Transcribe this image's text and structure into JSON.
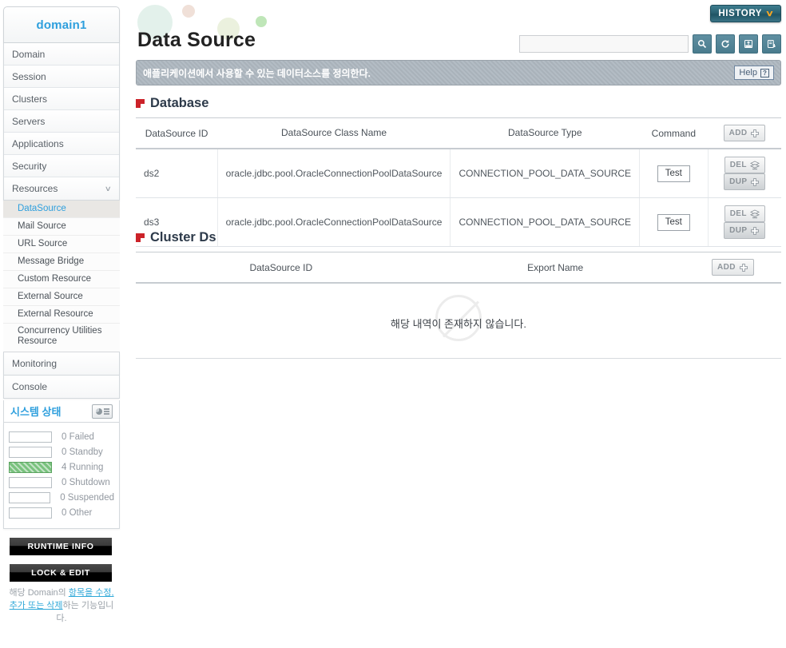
{
  "sidebar": {
    "domain_name": "domain1",
    "nav_items": [
      {
        "label": "Domain",
        "expandable": false
      },
      {
        "label": "Session",
        "expandable": false
      },
      {
        "label": "Clusters",
        "expandable": false
      },
      {
        "label": "Servers",
        "expandable": false
      },
      {
        "label": "Applications",
        "expandable": false
      },
      {
        "label": "Security",
        "expandable": false
      },
      {
        "label": "Resources",
        "expandable": true,
        "chevron": "∨"
      }
    ],
    "sub_items": [
      {
        "label": "DataSource",
        "active": true
      },
      {
        "label": "Mail Source",
        "active": false
      },
      {
        "label": "URL Source",
        "active": false
      },
      {
        "label": "Message Bridge",
        "active": false
      },
      {
        "label": "Custom Resource",
        "active": false
      },
      {
        "label": "External Source",
        "active": false
      },
      {
        "label": "External Resource",
        "active": false
      },
      {
        "label": "Concurrency Utilities Resource",
        "active": false
      }
    ],
    "nav_items_bottom": [
      {
        "label": "Monitoring"
      },
      {
        "label": "Console"
      }
    ],
    "system_status": {
      "title": "시스템 상태",
      "icon": "monitor-chart-icon",
      "rows": [
        {
          "count": "0",
          "label": "Failed",
          "filled": false
        },
        {
          "count": "0",
          "label": "Standby",
          "filled": false
        },
        {
          "count": "4",
          "label": "Running",
          "filled": true
        },
        {
          "count": "0",
          "label": "Shutdown",
          "filled": false
        },
        {
          "count": "0",
          "label": "Suspended",
          "filled": false
        },
        {
          "count": "0",
          "label": "Other",
          "filled": false
        }
      ]
    },
    "runtime_info_label": "RUNTIME INFO",
    "lock_edit_label": "LOCK & EDIT",
    "lock_note": {
      "prefix": "해당 Domain의 ",
      "link": "항목을 수정, 추가 또는 삭제",
      "suffix": "하는 기능입니다."
    }
  },
  "header": {
    "page_title": "Data Source",
    "history_label": "HISTORY",
    "history_chevron": "∨",
    "search_value": "",
    "search_placeholder": "",
    "tool_buttons": [
      {
        "name": "search-icon",
        "title": "Search"
      },
      {
        "name": "refresh-icon",
        "title": "Refresh"
      },
      {
        "name": "xml-export-icon",
        "title": "XML"
      },
      {
        "name": "report-export-icon",
        "title": "Export"
      }
    ]
  },
  "notice": {
    "text": "애플리케이션에서 사용할 수 있는 데이터소스를 정의한다.",
    "help_label": "Help",
    "help_icon": "?"
  },
  "database_section": {
    "title": "Database",
    "add_label": "ADD",
    "columns": [
      "DataSource ID",
      "DataSource Class Name",
      "DataSource Type",
      "Command",
      ""
    ],
    "rows": [
      {
        "id": "ds2",
        "class_name": "oracle.jdbc.pool.OracleConnectionPoolDataSource",
        "type": "CONNECTION_POOL_DATA_SOURCE",
        "command": "Test",
        "del_label": "DEL",
        "dup_label": "DUP"
      },
      {
        "id": "ds3",
        "class_name": "oracle.jdbc.pool.OracleConnectionPoolDataSource",
        "type": "CONNECTION_POOL_DATA_SOURCE",
        "command": "Test",
        "del_label": "DEL",
        "dup_label": "DUP"
      }
    ]
  },
  "cluster_section": {
    "title": "Cluster Ds",
    "add_label": "ADD",
    "columns": [
      "DataSource ID",
      "Export Name",
      ""
    ],
    "empty_text": "해당 내역이 존재하지 않습니다."
  },
  "colors": {
    "accent_blue": "#2e9fdd",
    "section_red": "#cc2229",
    "history_teal": "#2b6172",
    "history_chevron_orange": "#f5a623",
    "running_green": "#79c27e",
    "notice_gray": "#a9b2ba"
  }
}
